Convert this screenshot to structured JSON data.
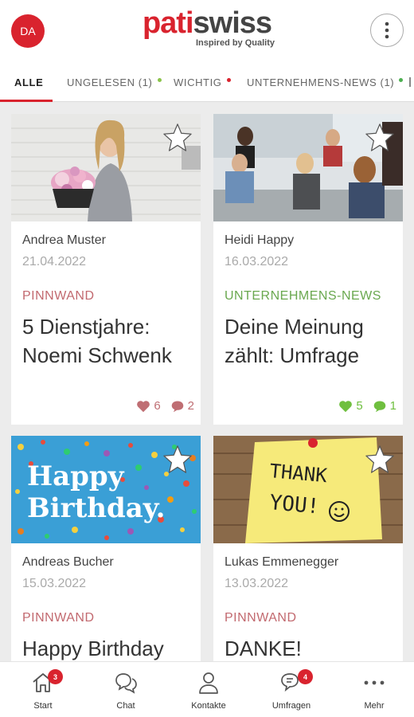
{
  "header": {
    "avatar_initials": "DA",
    "logo_part1": "pati",
    "logo_part2": "swiss",
    "tagline": "Inspired by Quality",
    "menu_icon": "vertical-ellipsis-icon"
  },
  "tabs": [
    {
      "label": "ALLE",
      "active": true
    },
    {
      "label": "UNGELESEN (1)",
      "dot_color": "#8bc34a"
    },
    {
      "label": "WICHTIG",
      "dot_color": "#d9232e"
    },
    {
      "label": "UNTERNEHMENS-NEWS (1)",
      "dot_color": "#4caf50"
    }
  ],
  "colors": {
    "brand_red": "#d9232e",
    "pinnwand": "#c2696f",
    "news_green": "#6aa84f",
    "like_pinnwand": "#bf6e73",
    "like_news": "#6fbf3f"
  },
  "posts": [
    {
      "author": "Andrea Muster",
      "date": "21.04.2022",
      "category": "PINNWAND",
      "title": "5 Dienstjahre: Noemi Schwenk",
      "likes": "6",
      "comments": "2",
      "image": "woman-with-flowers-photo"
    },
    {
      "author": "Heidi Happy",
      "date": "16.03.2022",
      "category": "UNTERNEHMENS-NEWS",
      "title": "Deine Meinung zählt: Umfrage",
      "likes": "5",
      "comments": "1",
      "image": "office-meeting-photo"
    },
    {
      "author": "Andreas Bucher",
      "date": "15.03.2022",
      "category": "PINNWAND",
      "title": "Happy Birthday",
      "image": "happy-birthday-confetti-image",
      "image_text_1": "Happy",
      "image_text_2": "Birthday."
    },
    {
      "author": "Lukas Emmenegger",
      "date": "13.03.2022",
      "category": "PINNWAND",
      "title": "DANKE!",
      "image": "thank-you-sticky-note-image",
      "image_text_1": "THANK",
      "image_text_2": "YOU!"
    }
  ],
  "bottom_nav": [
    {
      "label": "Start",
      "icon": "home-icon",
      "badge": "3"
    },
    {
      "label": "Chat",
      "icon": "chat-bubbles-icon"
    },
    {
      "label": "Kontakte",
      "icon": "person-icon"
    },
    {
      "label": "Umfragen",
      "icon": "survey-chat-icon",
      "badge": "4"
    },
    {
      "label": "Mehr",
      "icon": "horizontal-ellipsis-icon"
    }
  ]
}
